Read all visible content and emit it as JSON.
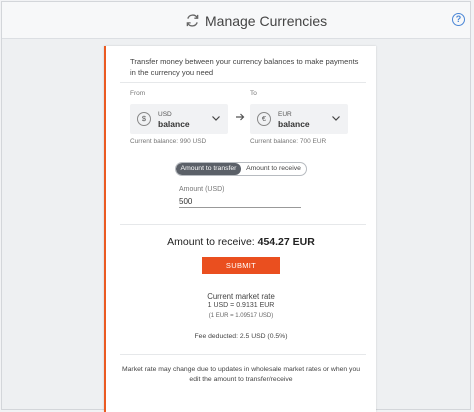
{
  "header": {
    "title": "Manage Currencies"
  },
  "intro": "Transfer money between your currency balances to make payments in the currency you need",
  "from": {
    "label": "From",
    "symbol": "$",
    "code": "USD",
    "name": "balance",
    "current_balance": "Current balance: 990 USD"
  },
  "to": {
    "label": "To",
    "symbol": "€",
    "code": "EUR",
    "name": "balance",
    "current_balance": "Current balance: 700 EUR"
  },
  "tabs": [
    {
      "label": "Amount to transfer",
      "active": true
    },
    {
      "label": "Amount to receive",
      "active": false
    }
  ],
  "amount": {
    "label": "Amount (USD)",
    "value": "500"
  },
  "receive": {
    "label": "Amount to receive:",
    "value": "454.27 EUR"
  },
  "submit_label": "SUBMIT",
  "rate": {
    "title": "Current market rate",
    "line1": "1 USD = 0.9131 EUR",
    "line2": "(1 EUR = 1.09517 USD)"
  },
  "fee": "Fee deducted: 2.5 USD (0.5%)",
  "footer_note": "Market rate may change due to updates in wholesale market rates or when you edit the amount to transfer/receive",
  "colors": {
    "accent": "#ea4f1f",
    "help": "#4a86d6",
    "tab_active": "#5b6068"
  },
  "icons": [
    "sync-icon",
    "help-icon",
    "dollar-icon",
    "euro-icon",
    "chevron-down-icon",
    "arrow-right-icon"
  ]
}
